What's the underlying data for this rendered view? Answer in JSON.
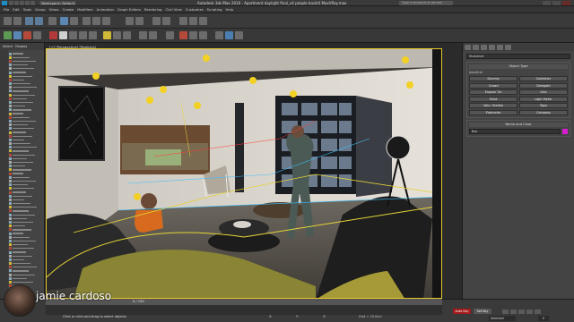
{
  "window": {
    "workspace": "Workspace: Default",
    "title": "Autodesk 3ds Max 2016 - Apartment daylight final_v4 people backlit MaxVRay.max",
    "search_placeholder": "Type a keyword or phrase"
  },
  "menu": [
    "File",
    "Edit",
    "Tools",
    "Group",
    "Views",
    "Create",
    "Modifiers",
    "Animation",
    "Graph Editors",
    "Rendering",
    "Civil View",
    "Customize",
    "Scripting",
    "Help"
  ],
  "left_panel": {
    "tabs": [
      "Select",
      "Display"
    ],
    "rows": 68
  },
  "viewport": {
    "label": "[+] [Perspective] [Realistic]"
  },
  "command_panel": {
    "dropdown": "Standard",
    "object_type": {
      "title": "Object Type",
      "autogrid": "AutoGrid",
      "buttons": [
        "Dummy",
        "Container",
        "Crowd",
        "Delegate",
        "Expose Tm",
        "Grid",
        "Point",
        "Light Meter",
        "Volu. Section",
        "Tape",
        "Protractor",
        "Compass"
      ]
    },
    "name_color": {
      "title": "Name and Color",
      "name": "Box",
      "color": "#d81dd0"
    }
  },
  "status": {
    "presenter": "jamie cardoso",
    "frame": "0 / 100",
    "status_text": "Click or click-and-drag to select objects",
    "x": "X:",
    "y": "Y:",
    "z": "Z:",
    "grid": "Grid = 10.0cm",
    "auto_key": "Auto Key",
    "set_key": "Set Key",
    "selected": "Selected",
    "frame_num": "0"
  }
}
